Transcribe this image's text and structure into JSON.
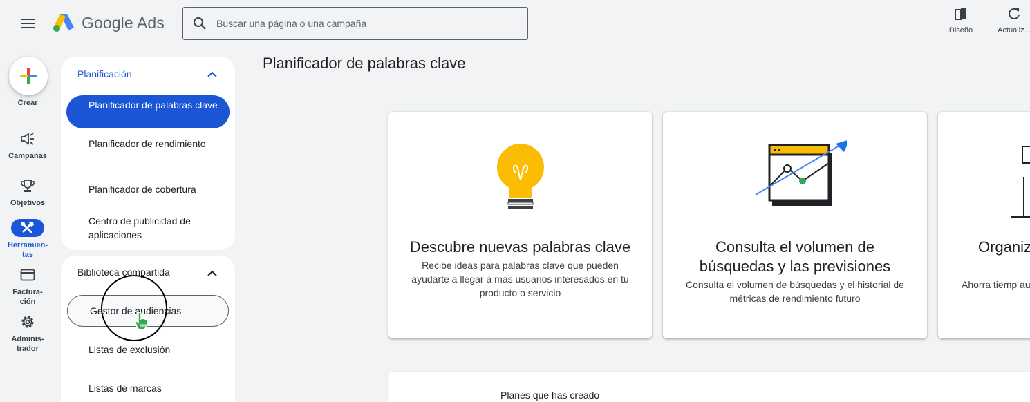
{
  "header": {
    "app_name": "Google Ads",
    "search_placeholder": "Buscar una página o una campaña",
    "tools": [
      {
        "label": "Diseño",
        "icon": "layout-icon"
      },
      {
        "label": "Actualiz...",
        "icon": "refresh-icon"
      }
    ]
  },
  "rail": {
    "create_label": "Crear",
    "items": [
      {
        "label": "Campañas",
        "icon": "megaphone-icon",
        "active": false
      },
      {
        "label": "Objetivos",
        "icon": "trophy-icon",
        "active": false
      },
      {
        "label": "Herramien-\ntas",
        "icon": "tools-icon",
        "active": true
      },
      {
        "label": "Factura-\nción",
        "icon": "credit-card-icon",
        "active": false
      },
      {
        "label": "Adminis-\ntrador",
        "icon": "gear-icon",
        "active": false
      }
    ]
  },
  "sidenav": {
    "planning": {
      "title": "Planificación",
      "items": [
        "Planificador de palabras clave",
        "Planificador de rendimiento",
        "Planificador de cobertura",
        "Centro de publicidad de aplicaciones"
      ]
    },
    "shared_library": {
      "title": "Biblioteca compartida",
      "items": [
        "Gestor de audiencias",
        "Listas de exclusión",
        "Listas de marcas"
      ]
    }
  },
  "main": {
    "title": "Planificador de palabras clave",
    "cards": [
      {
        "title": "Descubre nuevas palabras clave",
        "description": "Recibe ideas para palabras clave que pueden ayudarte a llegar a más usuarios interesados en tu producto o servicio",
        "icon": "lightbulb-icon"
      },
      {
        "title": "Consulta el volumen de búsquedas y las previsiones",
        "description": "Consulta el volumen de búsquedas y el historial de métricas de rendimiento futuro",
        "icon": "chart-trend-icon"
      },
      {
        "title": "Organiz grup",
        "description": "Ahorra tiemp automáticame",
        "icon": "group-icon"
      }
    ],
    "plans_title": "Planes que has creado"
  },
  "colors": {
    "accent": "#1a56d6",
    "bulb": "#fbbc04",
    "green": "#34a853"
  }
}
